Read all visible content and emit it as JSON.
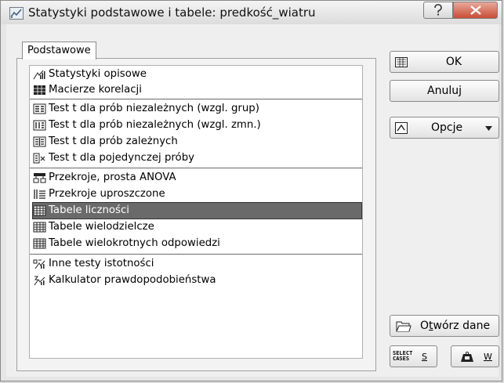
{
  "window": {
    "title": "Statystyki podstawowe i tabele: predkość_wiatru"
  },
  "tab": {
    "label": "Podstawowe"
  },
  "list": {
    "items": [
      {
        "label": "Statystyki opisowe",
        "icon": "bar-chart-icon"
      },
      {
        "label": "Macierze korelacji",
        "icon": "matrix-icon"
      },
      {
        "label": "Test t dla prób niezależnych (wzgl. grup)",
        "icon": "ttest-groups-icon"
      },
      {
        "label": "Test t dla prób niezależnych (wzgl. zmn.)",
        "icon": "ttest-vars-icon"
      },
      {
        "label": "Test t dla prób zależnych",
        "icon": "ttest-dependent-icon"
      },
      {
        "label": "Test t dla pojedynczej próby",
        "icon": "ttest-single-icon"
      },
      {
        "label": "Przekroje, prosta ANOVA",
        "icon": "breakdown-icon"
      },
      {
        "label": "Przekroje uproszczone",
        "icon": "simple-breakdown-icon"
      },
      {
        "label": "Tabele liczności",
        "icon": "frequency-table-icon"
      },
      {
        "label": "Tabele wielodzielcze",
        "icon": "crosstab-icon"
      },
      {
        "label": "Tabele wielokrotnych odpowiedzi",
        "icon": "multiresponse-table-icon"
      },
      {
        "label": "Inne testy istotności",
        "icon": "significance-test-icon"
      },
      {
        "label": "Kalkulator prawdopodobieństwa",
        "icon": "probability-calculator-icon"
      }
    ],
    "selected_item": "Tabele liczności"
  },
  "buttons": {
    "ok": "OK",
    "cancel": "Anuluj",
    "options": "Opcje",
    "open_data_pre": "O",
    "open_data_u": "t",
    "open_data_post": "wórz dane",
    "select_cases_line1": "SELECT",
    "select_cases_line2": "CASES",
    "select_cases_key": "S",
    "weight_key": "W"
  },
  "colors": {
    "selected_bg": "#6a6a6a",
    "close_button": "#c94d35"
  }
}
